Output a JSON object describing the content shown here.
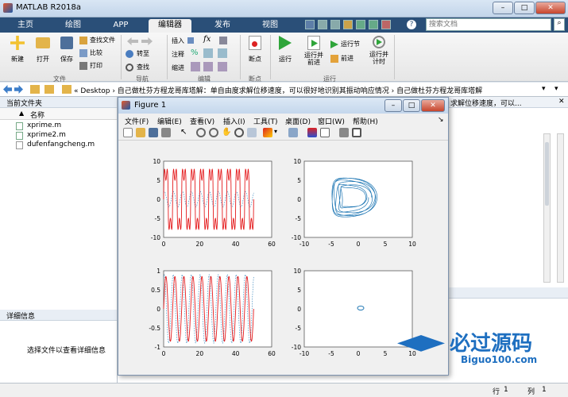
{
  "window": {
    "title": "MATLAB R2018a",
    "min": "–",
    "max": "□",
    "close": "✕"
  },
  "tabs": [
    {
      "label": "主页"
    },
    {
      "label": "绘图"
    },
    {
      "label": "APP"
    },
    {
      "label": "编辑器"
    },
    {
      "label": "发布"
    },
    {
      "label": "视图"
    }
  ],
  "search": {
    "placeholder": "搜索文档"
  },
  "ribbon": {
    "new": "新建",
    "open": "打开",
    "save": "保存",
    "find_files": "查找文件",
    "compare": "比较",
    "print": "打印",
    "insert": "插入",
    "comment": "注释",
    "indent": "缩进",
    "goto": "转至",
    "find": "查找",
    "breakpoints": "断点",
    "run": "运行",
    "run_advance": "运行并\n前进",
    "run_section": "运行节",
    "advance": "前进",
    "run_time": "运行并\n计时",
    "groups": {
      "file": "文件",
      "navigate": "导航",
      "edit": "编辑",
      "breakpoints": "断点",
      "run": "运行"
    }
  },
  "address": {
    "path": "« Desktop › 自己做杜芬方程龙哥库塔解：单自由度求解位移速度，可以很好地识别其振动响应情况 › 自己做杜芬方程龙哥库塔解",
    "right_text": "求解位移速度，可以..."
  },
  "current_folder": {
    "title": "当前文件夹",
    "col_name": "名称",
    "files": [
      {
        "name": "xprime.m"
      },
      {
        "name": "xprime2.m"
      },
      {
        "name": "dufenfangcheng.m"
      }
    ]
  },
  "details": {
    "title": "详细信息",
    "hint": "选择文件以查看详细信息"
  },
  "status": {
    "row_label": "行",
    "row": "1",
    "col_label": "列",
    "col": "1"
  },
  "figure": {
    "title": "Figure 1",
    "menu": [
      "文件(F)",
      "编辑(E)",
      "查看(V)",
      "插入(I)",
      "工具(T)",
      "桌面(D)",
      "窗口(W)",
      "帮助(H)"
    ]
  },
  "watermark": {
    "text": "必过源码",
    "url": "Biguo100.com"
  },
  "colors": {
    "accent": "#2a4f78",
    "red": "#e41a1c",
    "blue": "#1f77b4"
  },
  "chart_data": [
    {
      "type": "line",
      "x_range": [
        0,
        60
      ],
      "ylim": [
        -10,
        10
      ],
      "xticks": [
        0,
        20,
        40,
        60
      ],
      "yticks": [
        -10,
        -5,
        0,
        5,
        10
      ],
      "series": [
        {
          "values": "oscillation",
          "color": "#e41a1c"
        },
        {
          "values": "oscillation dotted",
          "color": "#1f77b4"
        }
      ]
    },
    {
      "type": "line",
      "xlim": [
        -10,
        10
      ],
      "ylim": [
        -10,
        10
      ],
      "xticks": [
        -10,
        -5,
        0,
        5,
        10
      ],
      "yticks": [
        -10,
        -5,
        0,
        5,
        10
      ]
    },
    {
      "type": "line",
      "x_range": [
        0,
        60
      ],
      "ylim": [
        -1,
        1
      ],
      "xticks": [
        0,
        20,
        40,
        60
      ],
      "yticks": [
        -1,
        -0.5,
        0,
        0.5,
        1
      ]
    },
    {
      "type": "line",
      "xlim": [
        -10,
        10
      ],
      "ylim": [
        -10,
        10
      ],
      "xticks": [
        -10,
        -5,
        0,
        5,
        10
      ],
      "yticks": [
        -10,
        -5,
        0,
        5,
        10
      ]
    }
  ]
}
